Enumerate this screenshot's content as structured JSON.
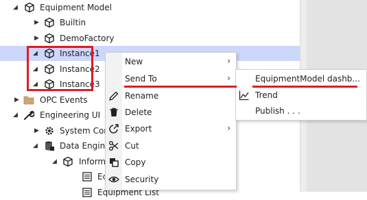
{
  "tree": {
    "items": [
      {
        "label": "Equipment Model",
        "icon": "cube-icon",
        "expander": "expanded"
      },
      {
        "label": "Builtin",
        "icon": "cube-icon",
        "expander": "collapsed"
      },
      {
        "label": "DemoFactory",
        "icon": "cube-icon",
        "expander": "collapsed"
      },
      {
        "label": "Instance1",
        "icon": "cube-icon",
        "expander": "expanded",
        "selected": true
      },
      {
        "label": "Instance2",
        "icon": "cube-icon",
        "expander": "expanded"
      },
      {
        "label": "Instance3",
        "icon": "cube-icon",
        "expander": "expanded"
      },
      {
        "label": "OPC Events",
        "icon": "folder-icon",
        "expander": "collapsed"
      },
      {
        "label": "Engineering UI",
        "icon": "wrench-icon",
        "expander": "expanded"
      },
      {
        "label": "System Con",
        "icon": "gear-icon",
        "expander": "collapsed"
      },
      {
        "label": "Data Engine",
        "icon": "database-icon",
        "expander": "expanded"
      },
      {
        "label": "Inform",
        "icon": "cube-icon",
        "expander": "expanded"
      },
      {
        "label": "Ec",
        "icon": "list-icon",
        "expander": "none"
      },
      {
        "label": "Equipment List",
        "icon": "list-icon",
        "expander": "none"
      }
    ]
  },
  "context_menu": {
    "items": [
      {
        "label": "New",
        "icon": "",
        "has_submenu": true
      },
      {
        "label": "Send To",
        "icon": "",
        "has_submenu": true
      },
      {
        "label": "Rename",
        "icon": "pencil-icon",
        "has_submenu": false
      },
      {
        "label": "Delete",
        "icon": "trash-icon",
        "has_submenu": false
      },
      {
        "label": "Export",
        "icon": "export-icon",
        "has_submenu": true
      },
      {
        "label": "Cut",
        "icon": "scissors-icon",
        "has_submenu": false
      },
      {
        "label": "Copy",
        "icon": "copy-icon",
        "has_submenu": false
      },
      {
        "label": "Security",
        "icon": "eye-icon",
        "has_submenu": false
      }
    ],
    "submenu_arrow": "›"
  },
  "send_to_submenu": {
    "items": [
      {
        "label": "EquipmentModel dashb...",
        "icon": ""
      },
      {
        "label": "Trend",
        "icon": "trend-icon"
      },
      {
        "label": "Publish . . .",
        "icon": ""
      }
    ]
  },
  "colors": {
    "selection": "#ccd7fb",
    "highlight_red": "#e01a22"
  }
}
